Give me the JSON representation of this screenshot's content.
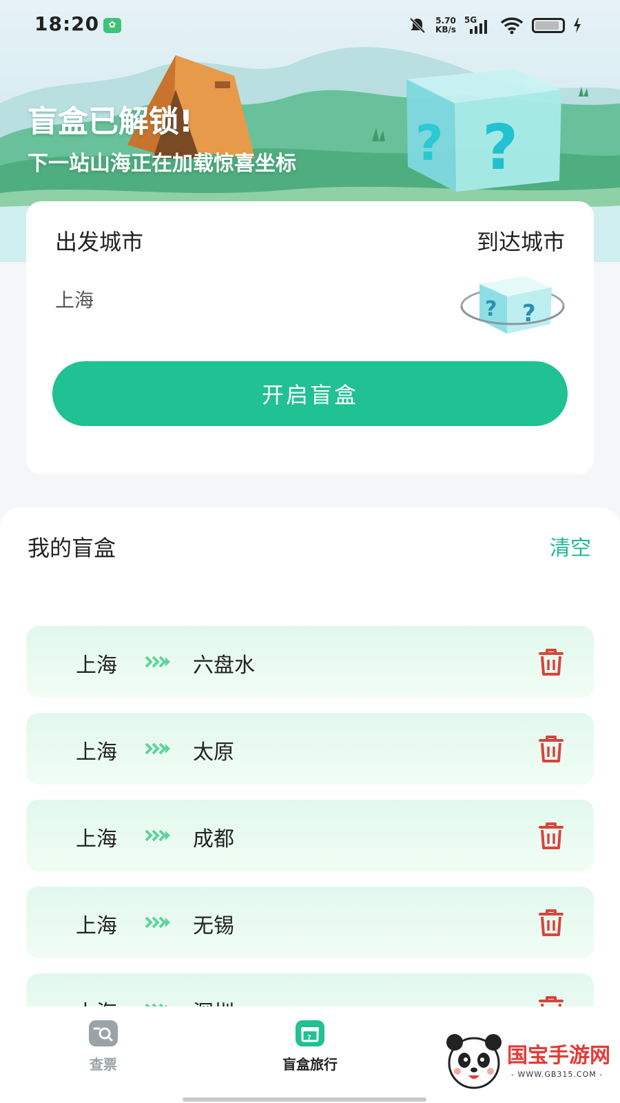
{
  "status_bar": {
    "time": "18:20",
    "network_speed_value": "5.70",
    "network_speed_unit": "KB/s",
    "network_type": "5G",
    "icons": [
      "app-notification-icon",
      "mute-bell-icon",
      "signal-icon",
      "wifi-icon",
      "battery-icon",
      "charging-icon"
    ]
  },
  "hero": {
    "title": "盲盒已解锁!",
    "subtitle": "下一站山海正在加载惊喜坐标"
  },
  "city_card": {
    "depart_label": "出发城市",
    "arrive_label": "到达城市",
    "depart_value": "上海",
    "open_button_label": "开启盲盒"
  },
  "my_boxes": {
    "title": "我的盲盒",
    "clear_label": "清空",
    "items": [
      {
        "from": "上海",
        "to": "六盘水"
      },
      {
        "from": "上海",
        "to": "太原"
      },
      {
        "from": "上海",
        "to": "成都"
      },
      {
        "from": "上海",
        "to": "无锡"
      },
      {
        "from": "上海",
        "to": "深圳"
      }
    ]
  },
  "tab_bar": {
    "tabs": [
      {
        "label": "查票",
        "icon": "ticket-search-icon",
        "active": false
      },
      {
        "label": "盲盒旅行",
        "icon": "gift-box-icon",
        "active": true
      }
    ]
  },
  "watermark": {
    "text": "国宝手游网",
    "url": "- WWW.GB315.COM -"
  },
  "colors": {
    "accent": "#20c192",
    "delete": "#d8443c",
    "clear_link": "#20b69a"
  }
}
